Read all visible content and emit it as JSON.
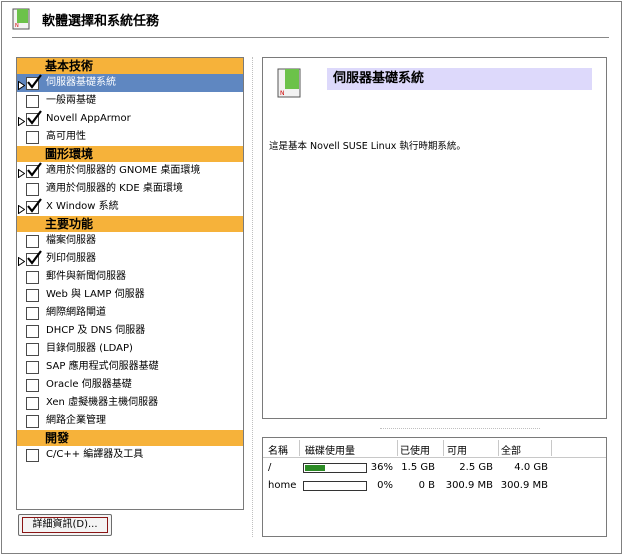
{
  "window": {
    "title": "軟體選擇和系統任務"
  },
  "categories": [
    {
      "label": "基本技術",
      "items": [
        {
          "label": "伺服器基礎系統",
          "checked": true,
          "selected": true,
          "marker": true
        },
        {
          "label": "一般兩基礎",
          "checked": false
        },
        {
          "label": "Novell AppArmor",
          "checked": true,
          "marker": true
        },
        {
          "label": "高可用性",
          "checked": false
        }
      ]
    },
    {
      "label": "圖形環境",
      "items": [
        {
          "label": "適用於伺服器的 GNOME 桌面環境",
          "checked": true,
          "marker": true
        },
        {
          "label": "適用於伺服器的 KDE 桌面環境",
          "checked": false
        },
        {
          "label": "X Window 系統",
          "checked": true,
          "marker": true
        }
      ]
    },
    {
      "label": "主要功能",
      "items": [
        {
          "label": "檔案伺服器",
          "checked": false
        },
        {
          "label": "列印伺服器",
          "checked": true,
          "marker": true
        },
        {
          "label": "郵件與新聞伺服器",
          "checked": false
        },
        {
          "label": "Web 與 LAMP 伺服器",
          "checked": false
        },
        {
          "label": "網際網路閘道",
          "checked": false
        },
        {
          "label": "DHCP 及 DNS 伺服器",
          "checked": false
        },
        {
          "label": "目錄伺服器 (LDAP)",
          "checked": false
        },
        {
          "label": "SAP 應用程式伺服器基礎",
          "checked": false
        },
        {
          "label": "Oracle 伺服器基礎",
          "checked": false
        },
        {
          "label": "Xen 虛擬機器主機伺服器",
          "checked": false
        },
        {
          "label": "網路企業管理",
          "checked": false
        }
      ]
    },
    {
      "label": "開發",
      "items": [
        {
          "label": "C/C++ 編譯器及工具",
          "checked": false
        }
      ]
    }
  ],
  "details_button": {
    "label": "詳細資訊(D)..."
  },
  "description": {
    "title": "伺服器基礎系統",
    "text": "這是基本 Novell SUSE Linux 執行時期系統。"
  },
  "disk": {
    "headers": [
      "名稱",
      "磁碟使用量",
      "已使用",
      "可用",
      "全部"
    ],
    "rows": [
      {
        "name": "/",
        "percent_text": "36%",
        "percent": 36,
        "used": "1.5 GB",
        "free": "2.5 GB",
        "total": "4.0 GB"
      },
      {
        "name": "home",
        "percent_text": "0%",
        "percent": 0,
        "used": "0 B",
        "free": "300.9 MB",
        "total": "300.9 MB"
      }
    ]
  },
  "colors": {
    "category_bg": "#f6b23a",
    "selection_bg": "#5f87c1",
    "title_highlight": "#ddd9fb",
    "usage_fill": "#2c8b25"
  }
}
